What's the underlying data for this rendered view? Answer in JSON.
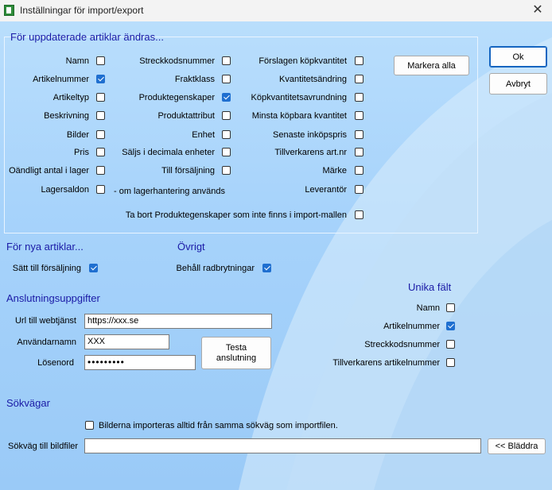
{
  "window": {
    "title": "Inställningar för import/export"
  },
  "update_group": {
    "heading": "För uppdaterade artiklar ändras...",
    "col1": [
      {
        "label": "Namn",
        "checked": false
      },
      {
        "label": "Artikelnummer",
        "checked": true
      },
      {
        "label": "Artikeltyp",
        "checked": false
      },
      {
        "label": "Beskrivning",
        "checked": false
      },
      {
        "label": "Bilder",
        "checked": false
      },
      {
        "label": "Pris",
        "checked": false
      },
      {
        "label": "Oändligt antal i lager",
        "checked": false
      },
      {
        "label": "Lagersaldon",
        "checked": false
      }
    ],
    "col1_note": "- om lagerhantering används",
    "col2": [
      {
        "label": "Streckkodsnummer",
        "checked": false
      },
      {
        "label": "Fraktklass",
        "checked": false
      },
      {
        "label": "Produktegenskaper",
        "checked": true
      },
      {
        "label": "Produktattribut",
        "checked": false
      },
      {
        "label": "Enhet",
        "checked": false
      },
      {
        "label": "Säljs i decimala enheter",
        "checked": false
      },
      {
        "label": "Till försäljning",
        "checked": false
      }
    ],
    "col3": [
      {
        "label": "Förslagen köpkvantitet",
        "checked": false
      },
      {
        "label": "Kvantitetsändring",
        "checked": false
      },
      {
        "label": "Köpkvantitetsavrundning",
        "checked": false
      },
      {
        "label": "Minsta köpbara kvantitet",
        "checked": false
      },
      {
        "label": "Senaste inköpspris",
        "checked": false
      },
      {
        "label": "Tillverkarens art.nr",
        "checked": false
      },
      {
        "label": "Märke",
        "checked": false
      },
      {
        "label": "Leverantör",
        "checked": false
      }
    ],
    "remove_props": {
      "label": "Ta bort Produktegenskaper som inte finns i import-mallen",
      "checked": false
    },
    "mark_all_label": "Markera alla"
  },
  "buttons": {
    "ok": "Ok",
    "cancel": "Avbryt"
  },
  "new_articles": {
    "heading": "För nya artiklar...",
    "for_sale": {
      "label": "Sätt till försäljning",
      "checked": true
    }
  },
  "other": {
    "heading": "Övrigt",
    "keep_linebreaks": {
      "label": "Behåll radbrytningar",
      "checked": true
    }
  },
  "connection": {
    "heading": "Anslutningsuppgifter",
    "url_label": "Url till webtjänst",
    "url_value": "https://xxx.se",
    "user_label": "Användarnamn",
    "user_value": "XXX",
    "password_label": "Lösenord",
    "password_value": "•••••••••",
    "test_button": "Testa\nanslutning"
  },
  "unique_fields": {
    "heading": "Unika fält",
    "items": [
      {
        "label": "Namn",
        "checked": false
      },
      {
        "label": "Artikelnummer",
        "checked": true
      },
      {
        "label": "Streckkodsnummer",
        "checked": false
      },
      {
        "label": "Tillverkarens artikelnummer",
        "checked": false
      }
    ]
  },
  "paths": {
    "heading": "Sökvägar",
    "same_path": {
      "label": "Bilderna importeras alltid från samma sökväg som importfilen.",
      "checked": false
    },
    "image_path_label": "Sökväg till bildfiler",
    "image_path_value": "",
    "browse_button": "<< Bläddra"
  }
}
